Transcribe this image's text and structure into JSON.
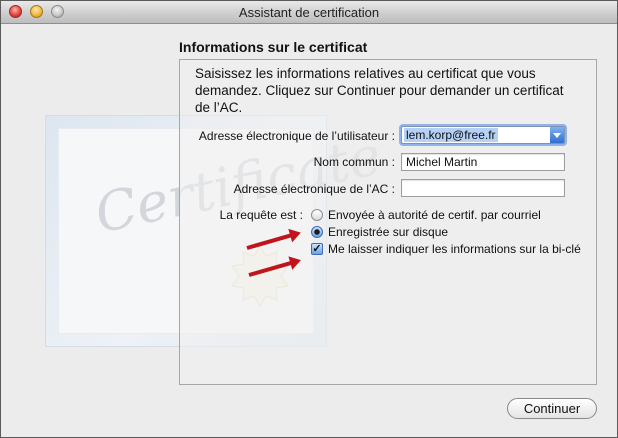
{
  "window": {
    "title": "Assistant de certification"
  },
  "background_watermark": "Certificate",
  "heading": "Informations sur le certificat",
  "intro": "Saisissez les informations relatives au certificat que vous demandez. Cliquez sur Continuer pour demander un certificat de l’AC.",
  "fields": {
    "user_email": {
      "label": "Adresse électronique de l’utilisateur :",
      "value": "lem.korp@free.fr"
    },
    "common_name": {
      "label": "Nom commun :",
      "value": "Michel Martin"
    },
    "ca_email": {
      "label": "Adresse électronique de l’AC :",
      "value": ""
    }
  },
  "request": {
    "label": "La requête est :",
    "options": [
      {
        "label": "Envoyée à autorité de certif. par courriel",
        "selected": false
      },
      {
        "label": "Enregistrée sur disque",
        "selected": true
      }
    ],
    "keypair_checkbox": {
      "label": "Me laisser indiquer les informations sur la bi-clé",
      "checked": true
    }
  },
  "buttons": {
    "continue": "Continuer"
  },
  "colors": {
    "annotation_arrow": "#c0151d",
    "focus_ring": "#91b4e8"
  }
}
